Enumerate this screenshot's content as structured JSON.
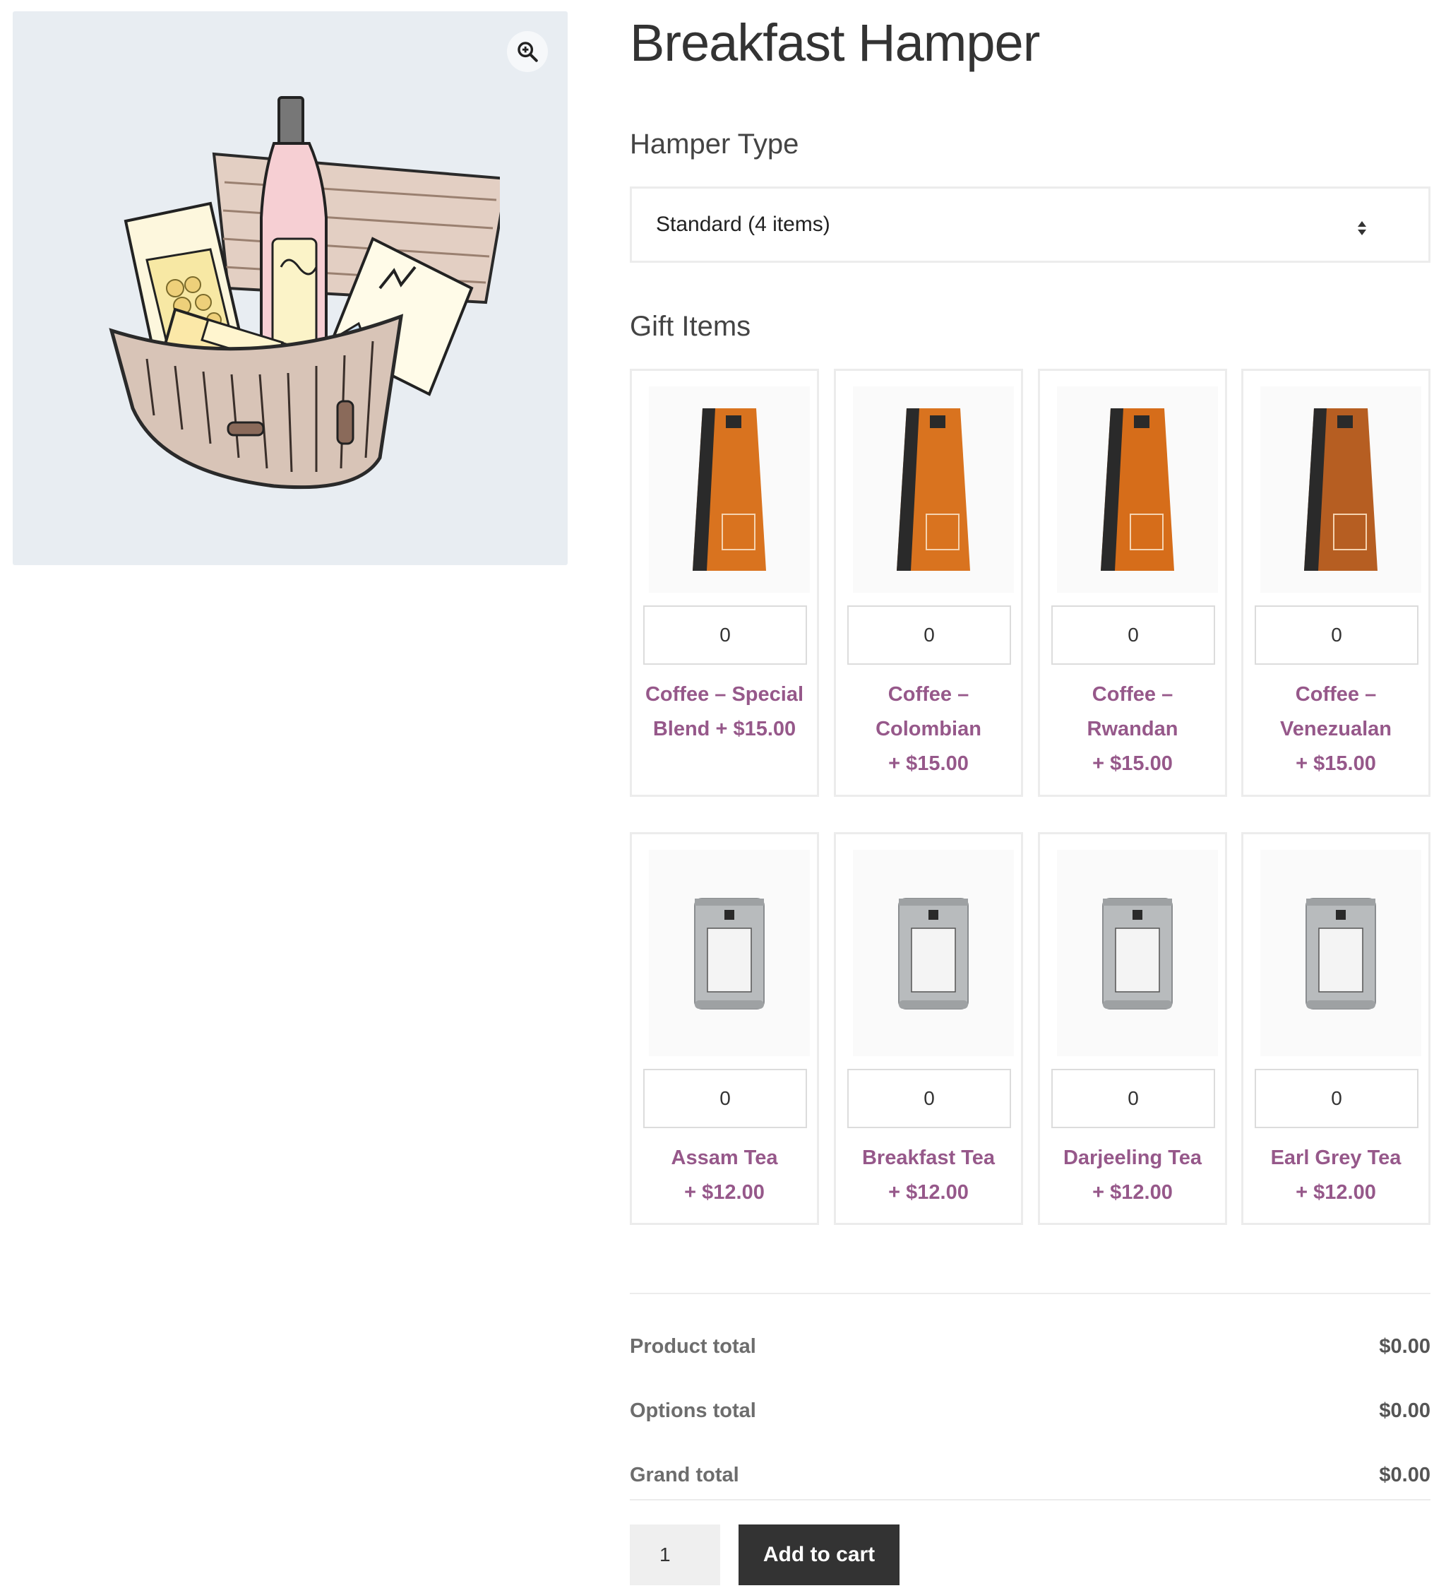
{
  "product": {
    "title": "Breakfast Hamper"
  },
  "gallery": {
    "zoom_icon": "zoom-in-icon",
    "image_subject": "breakfast-hamper-basket"
  },
  "hamper_type": {
    "label": "Hamper Type",
    "selected": "Standard (4 items)"
  },
  "gift_items": {
    "label": "Gift Items",
    "items": [
      {
        "name": "Coffee – Special Blend",
        "price": "+ $15.00",
        "qty": "0",
        "kind": "coffee"
      },
      {
        "name": "Coffee – Colombian",
        "price": "+ $15.00",
        "qty": "0",
        "kind": "coffee"
      },
      {
        "name": "Coffee – Rwandan",
        "price": "+ $15.00",
        "qty": "0",
        "kind": "coffee"
      },
      {
        "name": "Coffee – Venezualan",
        "price": "+ $15.00",
        "qty": "0",
        "kind": "coffee"
      },
      {
        "name": "Assam Tea",
        "price": "+ $12.00",
        "qty": "0",
        "kind": "tea"
      },
      {
        "name": "Breakfast Tea",
        "price": "+ $12.00",
        "qty": "0",
        "kind": "tea"
      },
      {
        "name": "Darjeeling Tea",
        "price": "+ $12.00",
        "qty": "0",
        "kind": "tea"
      },
      {
        "name": "Earl Grey Tea",
        "price": "+ $12.00",
        "qty": "0",
        "kind": "tea"
      }
    ]
  },
  "totals": {
    "product_total_label": "Product total",
    "product_total": "$0.00",
    "options_total_label": "Options total",
    "options_total": "$0.00",
    "grand_total_label": "Grand total",
    "grand_total": "$0.00"
  },
  "cart": {
    "quantity": "1",
    "button_label": "Add to cart"
  },
  "colors": {
    "link_purple": "#96588a",
    "button_dark": "#333333",
    "gallery_bg": "#e8edf2",
    "coffee_orange": "#d9731f",
    "tea_silver": "#b8bbbd"
  }
}
